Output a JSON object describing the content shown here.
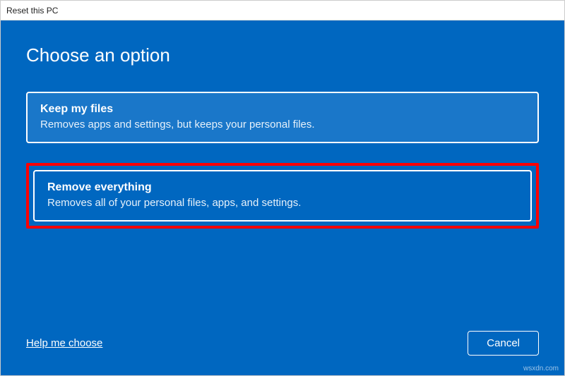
{
  "window": {
    "title": "Reset this PC"
  },
  "heading": "Choose an option",
  "options": {
    "keep": {
      "title": "Keep my files",
      "desc": "Removes apps and settings, but keeps your personal files."
    },
    "remove": {
      "title": "Remove everything",
      "desc": "Removes all of your personal files, apps, and settings."
    }
  },
  "footer": {
    "help": "Help me choose",
    "cancel": "Cancel"
  },
  "watermark": "wsxdn.com"
}
